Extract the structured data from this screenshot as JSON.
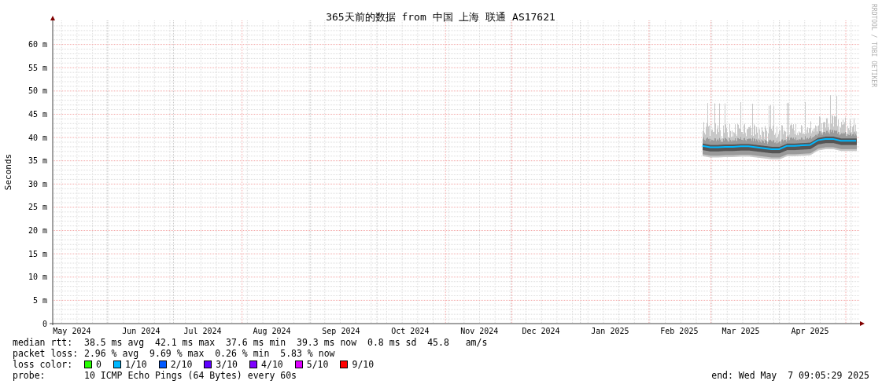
{
  "graph": {
    "chart_data": {
      "type": "line",
      "title": "365天前的数据 from 中国 上海 联通 AS17621",
      "ylabel": "Seconds",
      "grid": true,
      "ylim": [
        0,
        65
      ],
      "categories": [
        null,
        null,
        "May 2024",
        null,
        null,
        null,
        null,
        null,
        null,
        null,
        null,
        "Jun 2024",
        null,
        null,
        null,
        null,
        null,
        null,
        null,
        "Jul 2024",
        null,
        null,
        null,
        null,
        null,
        null,
        null,
        null,
        "Aug 2024",
        null,
        null,
        null,
        null,
        null,
        null,
        null,
        null,
        "Sep 2024",
        null,
        null,
        null,
        null,
        null,
        null,
        null,
        null,
        "Oct 2024",
        null,
        null,
        null,
        null,
        null,
        null,
        null,
        null,
        "Nov 2024",
        null,
        null,
        null,
        null,
        null,
        null,
        null,
        "Dec 2024",
        null,
        null,
        null,
        null,
        null,
        null,
        null,
        null,
        "Jan 2025",
        null,
        null,
        null,
        null,
        null,
        null,
        null,
        null,
        "Feb 2025",
        null,
        null,
        null,
        null,
        null,
        null,
        null,
        "Mar 2025",
        null,
        null,
        null,
        null,
        null,
        null,
        null,
        null,
        "Apr 2025",
        null,
        null,
        null,
        null,
        null,
        null
      ],
      "series": [
        {
          "color": "#00b8ff",
          "values": [
            null,
            null,
            null,
            null,
            null,
            null,
            null,
            null,
            null,
            null,
            null,
            null,
            null,
            null,
            null,
            null,
            null,
            null,
            null,
            null,
            null,
            null,
            null,
            null,
            null,
            null,
            null,
            null,
            null,
            null,
            null,
            null,
            null,
            null,
            null,
            null,
            null,
            null,
            null,
            null,
            null,
            null,
            null,
            null,
            null,
            null,
            null,
            null,
            null,
            null,
            null,
            null,
            null,
            null,
            null,
            null,
            null,
            null,
            null,
            null,
            null,
            null,
            null,
            null,
            null,
            null,
            null,
            null,
            null,
            null,
            null,
            null,
            null,
            null,
            null,
            null,
            null,
            null,
            null,
            null,
            null,
            null,
            null,
            null,
            38.2,
            37.9,
            37.9,
            38,
            38,
            38.1,
            38.1,
            37.9,
            37.7,
            37.5,
            37.5,
            38.2,
            38.2,
            38.3,
            38.4,
            39.4,
            39.7,
            39.7,
            39.3,
            39.3,
            39.3
          ]
        }
      ],
      "yticks": [
        {
          "value": 0,
          "label": "0"
        },
        {
          "value": 5,
          "label": "5 m"
        },
        {
          "value": 10,
          "label": "10 m"
        },
        {
          "value": 15,
          "label": "15 m"
        },
        {
          "value": 20,
          "label": "20 m"
        },
        {
          "value": 25,
          "label": "25 m"
        },
        {
          "value": 30,
          "label": "30 m"
        },
        {
          "value": 35,
          "label": "35 m"
        },
        {
          "value": 40,
          "label": "40 m"
        },
        {
          "value": 45,
          "label": "45 m"
        },
        {
          "value": 50,
          "label": "50 m"
        },
        {
          "value": 55,
          "label": "55 m"
        },
        {
          "value": 60,
          "label": "60 m"
        }
      ]
    },
    "credit": "RRDTOOL / TOBI OETIKER"
  },
  "legend": {
    "median_rtt": {
      "label": "median rtt:",
      "text": "38.5 ms avg  42.1 ms max  37.6 ms min  39.3 ms now  0.8 ms sd  45.8   am/s"
    },
    "packet_loss": {
      "label": "packet loss:",
      "text": "2.96 % avg  9.69 % max  0.26 % min  5.83 % now"
    },
    "loss_color": {
      "label": "loss color:",
      "items": [
        {
          "label": "0",
          "color": "#26ff00"
        },
        {
          "label": "1/10",
          "color": "#00b8ff"
        },
        {
          "label": "2/10",
          "color": "#0059ff"
        },
        {
          "label": "3/10",
          "color": "#5e00ff"
        },
        {
          "label": "4/10",
          "color": "#7e00ff"
        },
        {
          "label": "5/10",
          "color": "#dd00ff"
        },
        {
          "label": "9/10",
          "color": "#ff0000"
        }
      ]
    },
    "probe": {
      "label": "probe:",
      "text": "10 ICMP Echo Pings (64 Bytes) every 60s"
    },
    "end": "end: Wed May  7 09:05:29 2025"
  }
}
